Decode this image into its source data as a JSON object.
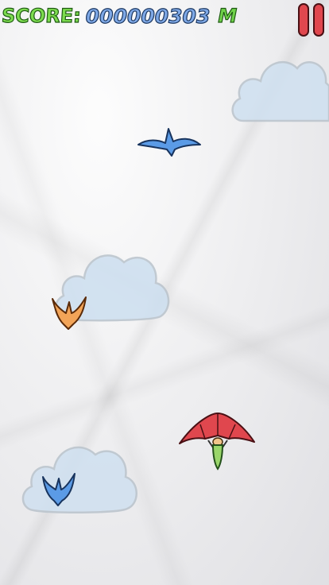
{
  "hud": {
    "score_label": "SCORE:",
    "score_value": "000000303",
    "score_unit": "M"
  },
  "colors": {
    "score_label": "#7ddc4f",
    "score_value": "#7ea8e6",
    "pause": "#e0474e",
    "glider_wing": "#e0474e",
    "pilot": "#9ad66a",
    "bird_blue": "#5b9be6",
    "bird_orange": "#f2a458",
    "cloud": "#c9dcee"
  },
  "icons": {
    "pause": "pause-icon",
    "player": "hang-glider-icon",
    "bird_flying": "bird-icon",
    "bird_orange": "orange-bird-icon",
    "bird_blue": "blue-bird-icon"
  }
}
